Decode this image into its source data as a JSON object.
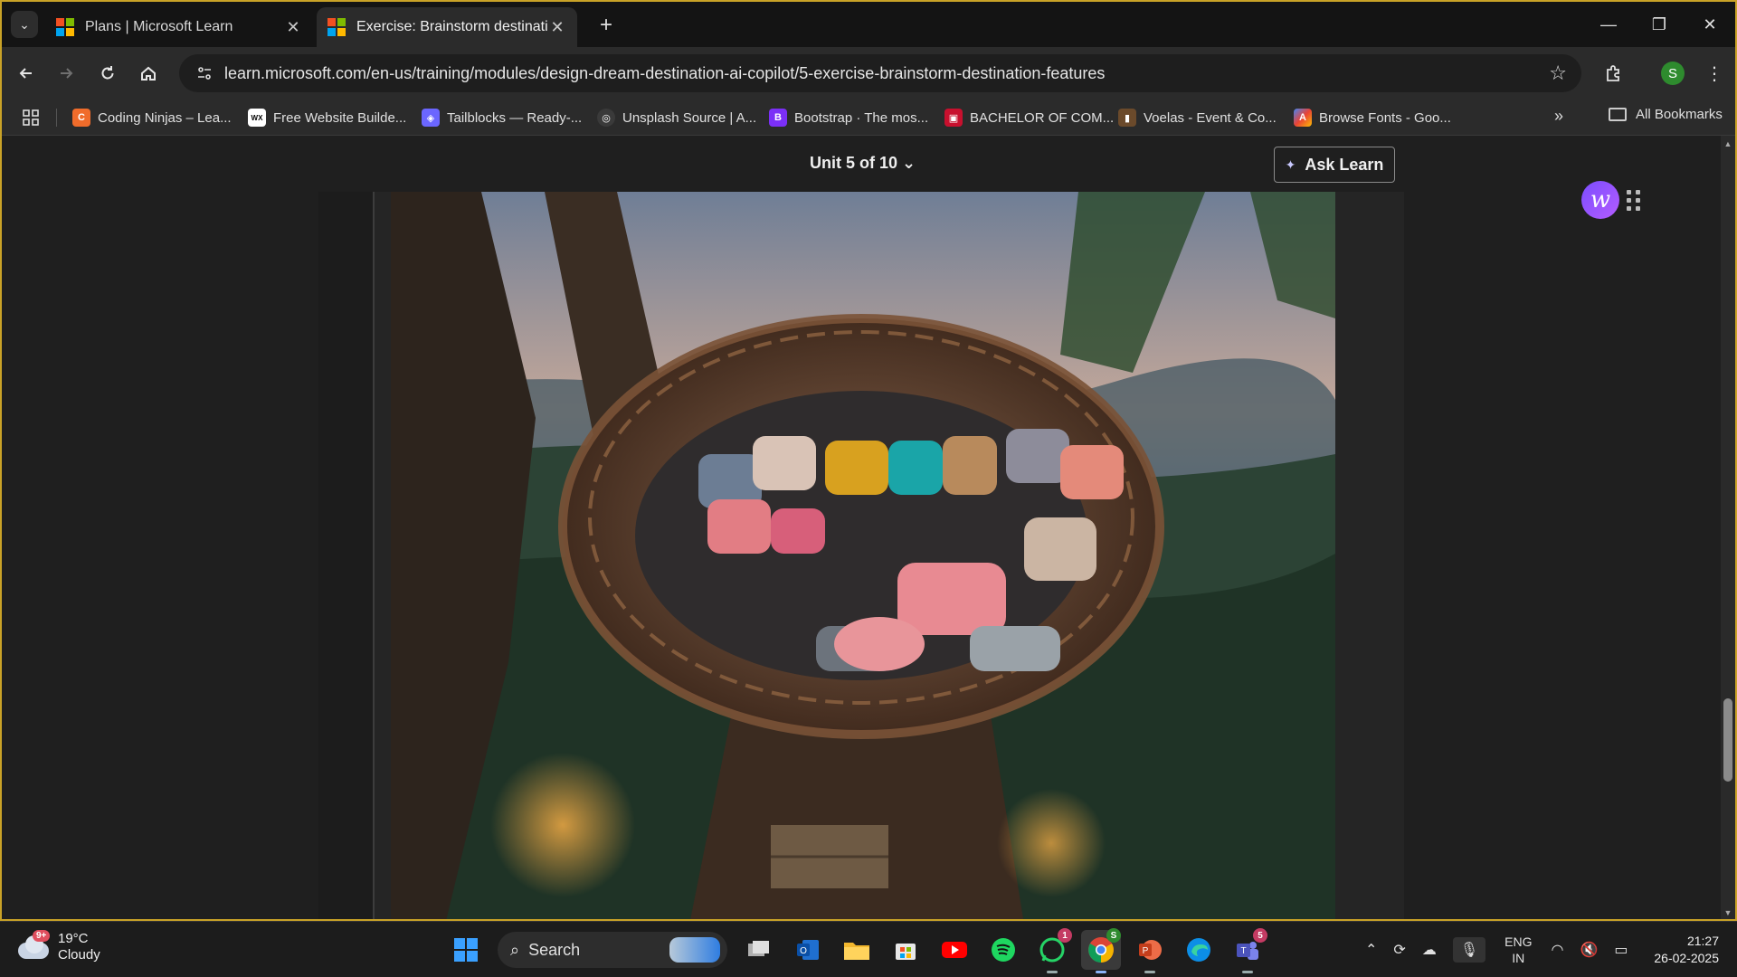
{
  "browser": {
    "tabs": [
      {
        "title": "Plans | Microsoft Learn",
        "close": "✕"
      },
      {
        "title": "Exercise: Brainstorm destination features",
        "close": "✕"
      }
    ],
    "new_tab": "+",
    "window_controls": {
      "minimize": "—",
      "restore": "❐",
      "close": "✕"
    },
    "address": "learn.microsoft.com/en-us/training/modules/design-dream-destination-ai-copilot/5-exercise-brainstorm-destination-features",
    "profile_initial": "S",
    "bookmarks": [
      {
        "label": "Coding Ninjas – Lea...",
        "favicon_color": "#f06c2b",
        "glyph": "C"
      },
      {
        "label": "Free Website Builde...",
        "favicon_color": "#ffffff",
        "glyph": "WX"
      },
      {
        "label": "Tailblocks — Ready-...",
        "favicon_color": "#6b66ff",
        "glyph": "◈"
      },
      {
        "label": "Unsplash Source | A...",
        "favicon_color": "#3a3a3a",
        "glyph": "◎"
      },
      {
        "label": "Bootstrap · The mos...",
        "favicon_color": "#7b2ff7",
        "glyph": "B"
      },
      {
        "label": "BACHELOR OF COM...",
        "favicon_color": "#c8102e",
        "glyph": "▣"
      },
      {
        "label": "Voelas - Event & Co...",
        "favicon_color": "#6b4a2b",
        "glyph": "▮"
      },
      {
        "label": "Browse Fonts - Goo...",
        "favicon_color": "#ea4335",
        "glyph": "A"
      }
    ],
    "more_bookmarks": "»",
    "all_bookmarks": "All Bookmarks"
  },
  "page": {
    "unit_nav": "Unit 5 of 10",
    "ask_learn": "Ask Learn",
    "ext_letter": "w",
    "image_alt": "Woven bird-nest treehouse with cushions overlooking a forest at sunset"
  },
  "taskbar": {
    "weather": {
      "temp": "19°C",
      "condition": "Cloudy",
      "badge": "9+"
    },
    "search_label": "Search",
    "badges": {
      "whatsapp": "1",
      "chrome": "S",
      "teams": "5"
    },
    "language": {
      "line1": "ENG",
      "line2": "IN"
    },
    "time": "21:27",
    "date": "26-02-2025"
  },
  "colors": {
    "frame": "#c9a227",
    "accent": "#7b4dff"
  }
}
